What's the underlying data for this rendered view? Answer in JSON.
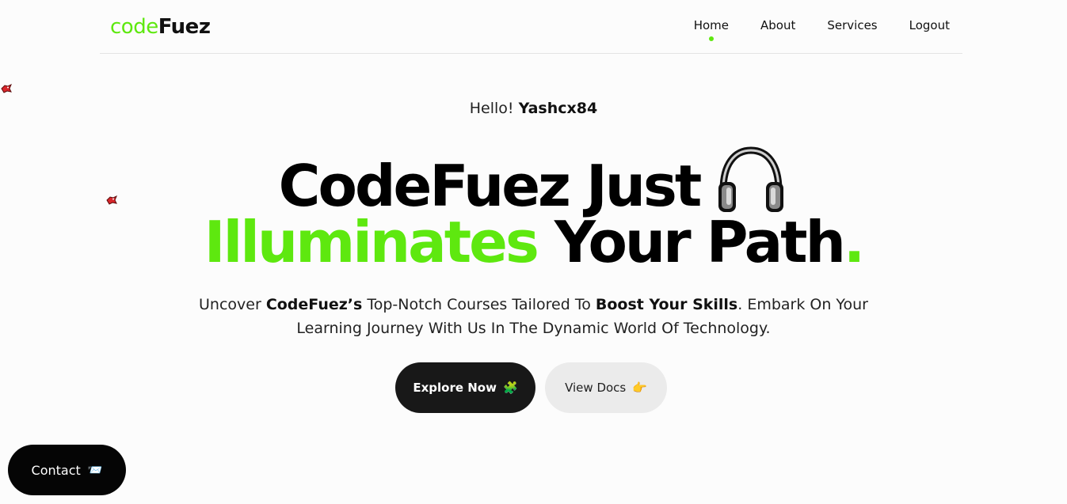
{
  "nav": {
    "logo_part1": "code",
    "logo_part2": "Fuez",
    "links": [
      "Home",
      "About",
      "Services",
      "Logout"
    ],
    "active_link": "Home"
  },
  "hero": {
    "greeting_prefix": "Hello!",
    "username": "Yashcx84",
    "headline_line1": "CodeFuez Just",
    "headline_highlight": "Illuminates",
    "headline_line2_rest": "Your Path",
    "headline_period": ".",
    "sub_part1": "Uncover ",
    "sub_bold1": "CodeFuez’s",
    "sub_part2": " Top-Notch Courses Tailored To ",
    "sub_bold2": "Boost Your Skills",
    "sub_part3": ". Embark On Your",
    "sub_line2": "Learning Journey With Us In The Dynamic World Of Technology."
  },
  "buttons": {
    "explore_label": "Explore Now",
    "explore_emoji": "🧩",
    "docs_label": "View Docs",
    "docs_emoji": "👉",
    "contact_label": "Contact",
    "contact_emoji": "📨"
  },
  "colors": {
    "accent": "#5ee80f",
    "dark": "#181818",
    "background": "#fcfcfc"
  },
  "icons": {
    "headline_icon": "headphones-icon",
    "floating_sprite": "red-bird-sprite-icon"
  }
}
